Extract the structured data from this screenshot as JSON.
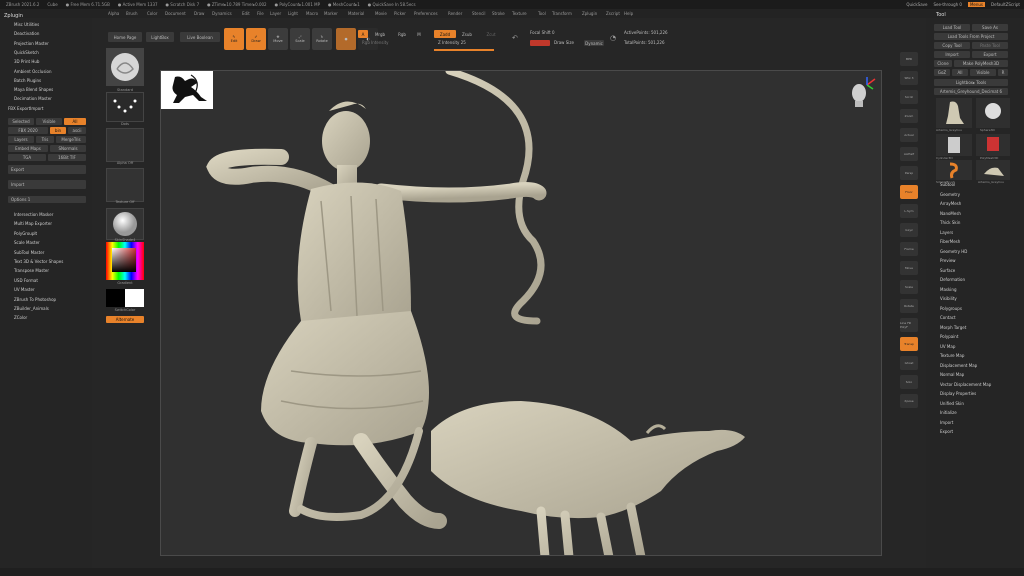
{
  "titlebar": {
    "items": [
      "ZBrush 2021.6.2",
      "Cube",
      "● Free Mem 6.71.5GB",
      "● Active Mem 1337",
      "● Scratch Disk 7",
      "● ZTime▸10.789 Timer▸0.002",
      "● PolyCount▸1.001 MP",
      "● MeshCount▸1",
      "● QuickSave In 58.5ecs"
    ],
    "quicksave": "QuickSave",
    "seethrough": "See-through 0",
    "menus_btn": "Menus",
    "script": "DefaultZScript"
  },
  "menubar": [
    "Alpha",
    "Brush",
    "Color",
    "Document",
    "Draw",
    "Dynamics",
    "Edit",
    "File",
    "Layer",
    "Light",
    "Macro",
    "Marker",
    "Material",
    "Movie",
    "Picker",
    "Preferences",
    "Render",
    "Stencil",
    "Stroke",
    "Texture",
    "Tool",
    "Transform",
    "Zplugin",
    "Zscript",
    "Help"
  ],
  "leftpanel": {
    "title": "Zplugin",
    "items_top": [
      "Misc Utilities",
      "Deactivation",
      "Projection Master",
      "QuickSketch",
      "3D Print Hub",
      "Ambient Occlusion",
      "Batch Plugins",
      "Maya Blend Shapes",
      "Decimation Master",
      "FBX ExportImport"
    ],
    "fbx_row1": [
      "Selected",
      "Visible",
      "All"
    ],
    "fbx_row2": [
      "FBX 2020",
      "bin",
      "ascii"
    ],
    "fbx_row3": [
      "Layers",
      "Tris",
      "MergeTris"
    ],
    "fbx_row4": [
      "Embed Maps",
      "SNormals"
    ],
    "fbx_row5": [
      "TGA",
      "16Bit TIF"
    ],
    "export": "Export",
    "import": "Import",
    "options": "Options 1",
    "items_bottom": [
      "Intersection Masker",
      "Multi Map Exporter",
      "PolyGroupIt",
      "Scale Master",
      "SubTool Master",
      "Text 3D & Vector Shapes",
      "Transpose Master",
      "USD Format",
      "UV Master",
      "ZBrush To Photoshop",
      "ZBuilder_Animals",
      "ZColor"
    ]
  },
  "shelf": {
    "brush_label": "Standard",
    "stroke_label": "Dots",
    "alpha_label": "Alpha Off",
    "texture_label": "Texture Off",
    "material_label": "SkinShade4",
    "gradient_label": "Gradient",
    "switch_label": "SwitchColor",
    "alternate_label": "Alternate"
  },
  "toolbar": {
    "home": "Home Page",
    "lightbox": "LightBox",
    "live_boolean": "Live Boolean",
    "edit": "Edit",
    "draw": "Draw",
    "move": "Move",
    "scale": "Scale",
    "rotate": "Rotate",
    "a_label": "A",
    "mrgb": "Mrgb",
    "rgb": "Rgb",
    "m": "M",
    "rgb_intensity": "Rgb Intensity",
    "zadd": "Zadd",
    "zsub": "Zsub",
    "zcut": "Zcut",
    "z_intensity": "Z Intensity 25",
    "focal_shift": "Focal Shift 0",
    "draw_size": "Draw Size",
    "dynamic": "Dynamic",
    "active_points": "ActivePoints: 501,226",
    "total_points": "TotalPoints: 501,226"
  },
  "toolpanel": {
    "title": "Tool",
    "row1": [
      "Load Tool",
      "Save As"
    ],
    "row2": [
      "Load Tools From Project"
    ],
    "row3": [
      "Copy Tool",
      "Paste Tool"
    ],
    "row4": [
      "Import",
      "Export"
    ],
    "row5": [
      "Clone",
      "Make PolyMesh3D"
    ],
    "row6": [
      "GoZ",
      "All",
      "Visible",
      "R"
    ],
    "row7": [
      "Lightbox▸ Tools"
    ],
    "current_tool": "Artemis_Greyhound_Decimat 6",
    "thumb_labels": [
      "Artemis_Greyhou",
      "Sphere3D",
      "Cylinder3D",
      "PolyMesh3D",
      "SimpleBrush",
      "Artemis_Greyhou"
    ],
    "items": [
      "Subtool",
      "Geometry",
      "ArrayMesh",
      "NanoMesh",
      "Thick Skin",
      "Layers",
      "FiberMesh",
      "Geometry HD",
      "Preview",
      "Surface",
      "Deformation",
      "Masking",
      "Visibility",
      "Polygroups",
      "Contact",
      "Morph Target",
      "Polypaint",
      "UV Map",
      "Texture Map",
      "Displacement Map",
      "Normal Map",
      "Vector Displacement Map",
      "Display Properties",
      "Unified Skin",
      "Initialize",
      "Import",
      "Export"
    ]
  },
  "rightcol": {
    "labels": [
      "BPR",
      "SPix 3",
      "Scroll",
      "Zoom",
      "Actual",
      "AAHalf",
      "Persp",
      "Floor",
      "L.Sym",
      "Gxyz",
      "Frame",
      "Move",
      "Scale",
      "Rotate",
      "Line Fill PolyF",
      "Transp",
      "Ghost",
      "Solo",
      "Xpose"
    ]
  },
  "colors": {
    "accent": "#e8822a",
    "panel": "#252525",
    "viewport": "#303030",
    "sculpt": "#c9c3ae"
  }
}
